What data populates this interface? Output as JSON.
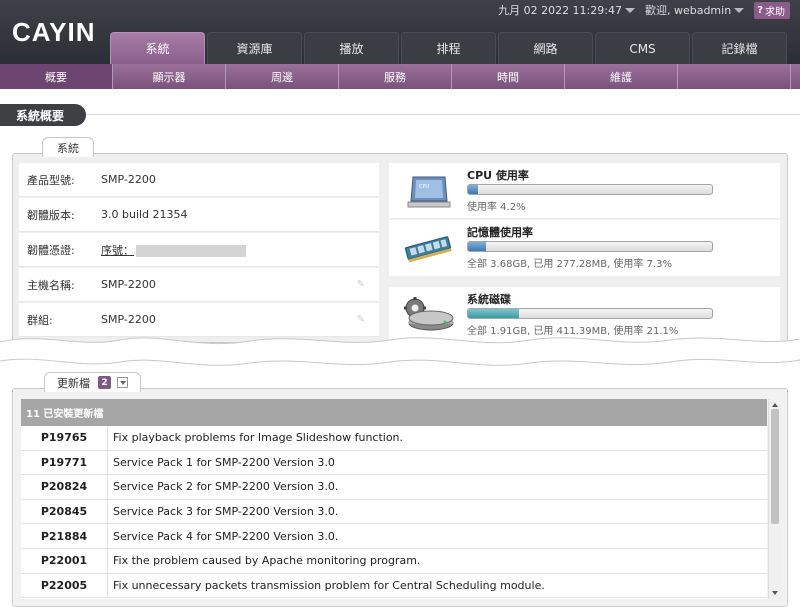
{
  "brand": {
    "logo_text": "CAYIN"
  },
  "topbar": {
    "datetime": "九月 02 2022 11:29:47",
    "greeting": "歡迎, webadmin",
    "help_label": "求助"
  },
  "main_tabs": [
    "系統",
    "資源庫",
    "播放",
    "排程",
    "網路",
    "CMS",
    "記錄檔"
  ],
  "sub_tabs": [
    "概要",
    "顯示器",
    "周邊",
    "服務",
    "時間",
    "維護",
    ""
  ],
  "page_title": "系統概要",
  "system_panel": {
    "tab_label": "系統",
    "info": [
      {
        "key": "產品型號:",
        "value": "SMP-2200"
      },
      {
        "key": "韌體版本:",
        "value": "3.0 build 21354"
      },
      {
        "key": "韌體憑證:",
        "value": "序號："
      },
      {
        "key": "主機名稱:",
        "value": "SMP-2200"
      },
      {
        "key": "群組:",
        "value": "SMP-2200"
      }
    ],
    "cpu": {
      "title": "CPU 使用率",
      "detail": "使用率 4.2%",
      "percent": 4.2
    },
    "memory": {
      "title": "記憶體使用率",
      "detail": "全部 3.68GB, 已用 277.28MB, 使用率 7.3%",
      "percent": 7.3
    },
    "disk": {
      "title": "系統磁碟",
      "detail": "全部 1.91GB, 已用 411.39MB, 使用率 21.1%",
      "percent": 21.1
    }
  },
  "updates_panel": {
    "tab_label": "更新檔",
    "badge": "2",
    "list_header": "11 已安裝更新檔",
    "rows": [
      {
        "id": "P19765",
        "desc": "Fix playback problems for Image Slideshow function."
      },
      {
        "id": "P19771",
        "desc": "Service Pack 1 for SMP-2200 Version 3.0"
      },
      {
        "id": "P20824",
        "desc": "Service Pack 2 for SMP-2200 Version 3.0."
      },
      {
        "id": "P20845",
        "desc": "Service Pack 3 for SMP-2200 Version 3.0."
      },
      {
        "id": "P21884",
        "desc": "Service Pack 4 for SMP-2200 Version 3.0."
      },
      {
        "id": "P22001",
        "desc": "Fix the problem caused by Apache monitoring program."
      },
      {
        "id": "P22005",
        "desc": "Fix unnecessary packets transmission problem for Central Scheduling module."
      }
    ]
  },
  "colors": {
    "accent": "#8a5f8b",
    "header": "#2b2e33",
    "bar_fill": "#3f78b0"
  }
}
